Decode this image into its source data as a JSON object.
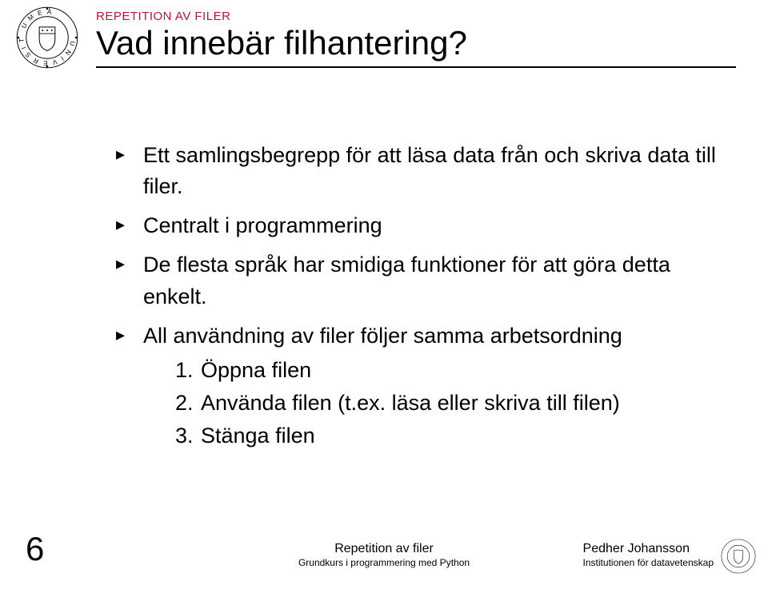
{
  "header": {
    "section_label": "REPETITION AV FILER",
    "title": "Vad innebär filhantering?"
  },
  "bullets": [
    "Ett samlingsbegrepp för att läsa data från och skriva data till filer.",
    "Centralt i programmering",
    "De flesta språk har smidiga funktioner för att göra detta enkelt.",
    "All användning av filer följer samma arbetsordning"
  ],
  "steps": [
    "Öppna filen",
    "Använda filen (t.ex. läsa eller skriva till filen)",
    "Stänga filen"
  ],
  "footer": {
    "page_number": "6",
    "center_line1": "Repetition av filer",
    "center_line2": "Grundkurs i programmering med Python",
    "right_line1": "Pedher Johansson",
    "right_line2": "Institutionen för datavetenskap"
  },
  "logo": {
    "name": "Umeå University seal",
    "ring_text": "UMEÅ • UNIVERSITET •"
  }
}
